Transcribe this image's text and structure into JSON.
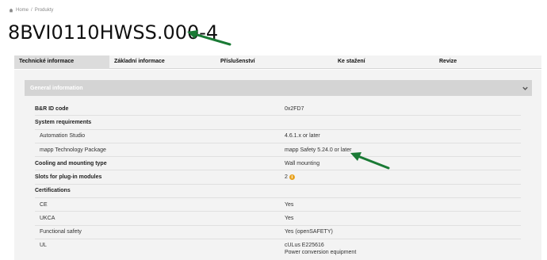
{
  "breadcrumb": {
    "home": "Home",
    "separator": "/",
    "current": "Produkty"
  },
  "page_title": "8BVI0110HWSS.000-4",
  "tabs": [
    {
      "label": "Technické informace",
      "active": true
    },
    {
      "label": "Základní informace",
      "active": false
    },
    {
      "label": "Příslušenství",
      "active": false
    },
    {
      "label": "Ke stažení",
      "active": false
    },
    {
      "label": "Revize",
      "active": false
    }
  ],
  "section": {
    "title": "General information"
  },
  "rows": [
    {
      "key": "B&R ID code",
      "value": "0x2FD7"
    },
    {
      "key": "System requirements",
      "value": ""
    },
    {
      "key": "Automation Studio",
      "value": "4.6.1.x or later"
    },
    {
      "key": "mapp Technology Package",
      "value": "mapp Safety 5.24.0 or later"
    },
    {
      "key": "Cooling and mounting type",
      "value": "Wall mounting"
    },
    {
      "key": "Slots for plug-in modules",
      "value": "2"
    },
    {
      "key": "Certifications",
      "value": ""
    },
    {
      "key": "CE",
      "value": "Yes"
    },
    {
      "key": "UKCA",
      "value": "Yes"
    },
    {
      "key": "Functional safety",
      "value": "Yes (openSAFETY)"
    },
    {
      "key": "UL",
      "value": "cULus E225616",
      "value2": "Power conversion equipment"
    }
  ],
  "info_icon": {
    "glyph": "i",
    "color": "#e8a321"
  },
  "colors": {
    "arrow": "#1a7a35",
    "tab_bar": "#f3f3f3",
    "active_tab": "#dcdcdc",
    "section_header": "#d4d4d4"
  }
}
